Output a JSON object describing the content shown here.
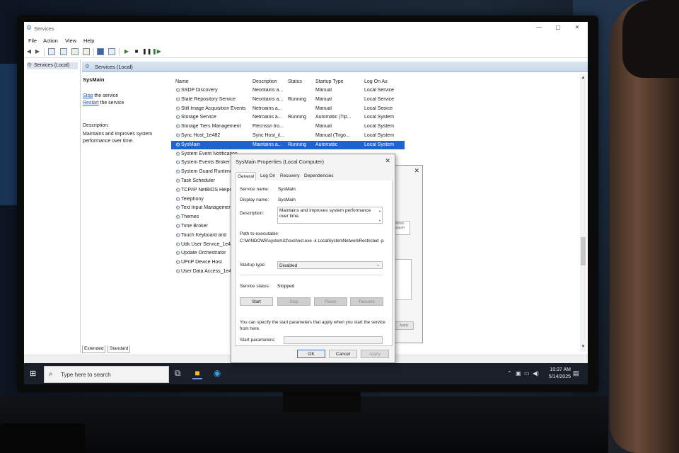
{
  "window": {
    "title": "Services",
    "controls": [
      "—",
      "▢",
      "✕"
    ]
  },
  "menu": [
    "File",
    "Action",
    "View",
    "Help"
  ],
  "tree": {
    "root": "Services (Local)"
  },
  "panel_header": "Services (Local)",
  "desc_pane": {
    "service_name": "SysMain",
    "stop_link": "Stop",
    "stop_rest": " the service",
    "restart_link": "Restart",
    "restart_rest": " the service",
    "desc_label": "Description:",
    "desc_text": "Maintains and improves system performance over time."
  },
  "columns": [
    "Name",
    "Description",
    "Status",
    "Startup Type",
    "Log On As"
  ],
  "services": [
    {
      "name": "SSDP Discovery",
      "desc": "Neontains a...",
      "status": "",
      "startup": "Manual",
      "logon": "Local Service"
    },
    {
      "name": "State Repository Service",
      "desc": "Neontains a...",
      "status": "Running",
      "startup": "Manual",
      "logon": "Local Service"
    },
    {
      "name": "Still Image Acquisition Events",
      "desc": "Netroains a...",
      "status": "",
      "startup": "Manual",
      "logon": "Local Seoice"
    },
    {
      "name": "Storage Service",
      "desc": "Netroains a...",
      "status": "Running",
      "startup": "Automatic (Tip...",
      "logon": "Local System"
    },
    {
      "name": "Storage Tiers Management",
      "desc": "Flecnssn tro...",
      "status": "",
      "startup": "Manual",
      "logon": "Local System"
    },
    {
      "name": "Sync Host_1e482",
      "desc": "Sync Host_il...",
      "status": "",
      "startup": "Manual (Tirgo...",
      "logon": "Local System"
    },
    {
      "name": "SysMain",
      "desc": "Maintains a...",
      "status": "Running",
      "startup": "Automatic",
      "logon": "Local System"
    },
    {
      "name": "System Event Notification",
      "desc": "",
      "status": "",
      "startup": "",
      "logon": ""
    },
    {
      "name": "System Events Broker",
      "desc": "",
      "status": "",
      "startup": "",
      "logon": ""
    },
    {
      "name": "System Guard Runtime",
      "desc": "",
      "status": "",
      "startup": "",
      "logon": ""
    },
    {
      "name": "Task Scheduler",
      "desc": "",
      "status": "",
      "startup": "",
      "logon": ""
    },
    {
      "name": "TCP/IP NetBIOS Helper",
      "desc": "",
      "status": "",
      "startup": "",
      "logon": ""
    },
    {
      "name": "Telephony",
      "desc": "",
      "status": "",
      "startup": "",
      "logon": ""
    },
    {
      "name": "Text Input Management",
      "desc": "",
      "status": "",
      "startup": "",
      "logon": ""
    },
    {
      "name": "Themes",
      "desc": "",
      "status": "",
      "startup": "",
      "logon": ""
    },
    {
      "name": "Time Broker",
      "desc": "",
      "status": "",
      "startup": "",
      "logon": ""
    },
    {
      "name": "Touch Keyboard and",
      "desc": "",
      "status": "",
      "startup": "",
      "logon": ""
    },
    {
      "name": "Udk User Service_1e48",
      "desc": "",
      "status": "",
      "startup": "",
      "logon": ""
    },
    {
      "name": "Update Orchestrator",
      "desc": "",
      "status": "",
      "startup": "",
      "logon": ""
    },
    {
      "name": "UPnP Device Host",
      "desc": "",
      "status": "",
      "startup": "",
      "logon": ""
    },
    {
      "name": "User Data Access_1e48",
      "desc": "",
      "status": "",
      "startup": "",
      "logon": ""
    }
  ],
  "bottom_tabs": [
    "Extended",
    "Standard"
  ],
  "dialog": {
    "title": "SysMain Properties (Local Computer)",
    "tabs": [
      "General",
      "Log On",
      "Recovery",
      "Dependencies"
    ],
    "service_name_label": "Service name:",
    "service_name": "SysMain",
    "display_name_label": "Display name:",
    "display_name": "SysMain",
    "description_label": "Description:",
    "description": "Maintains and improves system performance over time.",
    "path_label": "Path to executable:",
    "path": "C:\\WINDOWS\\system32\\svchost.exe -k LocalSystemNetworkRestricted -p",
    "startup_label": "Startup type:",
    "startup_value": "Disabled",
    "status_label": "Service status:",
    "status_value": "Stopped",
    "btn_start": "Start",
    "btn_stop": "Stop",
    "btn_pause": "Pause",
    "btn_resume": "Resume",
    "info": "You can specify the start parameters that apply when you start the service from here.",
    "params_label": "Start parameters:",
    "ok": "OK",
    "cancel": "Cancel",
    "apply": "Apply"
  },
  "back_dialog": {
    "inner_text": "ndows spaper",
    "button": "Apply"
  },
  "taskbar": {
    "search_placeholder": "Type here to search",
    "time": "10:37 AM",
    "date": "5/14/2025"
  },
  "colors": {
    "selection": "#1f63d1",
    "taskbar": "#1b1f2a",
    "link": "#1a55b3"
  }
}
